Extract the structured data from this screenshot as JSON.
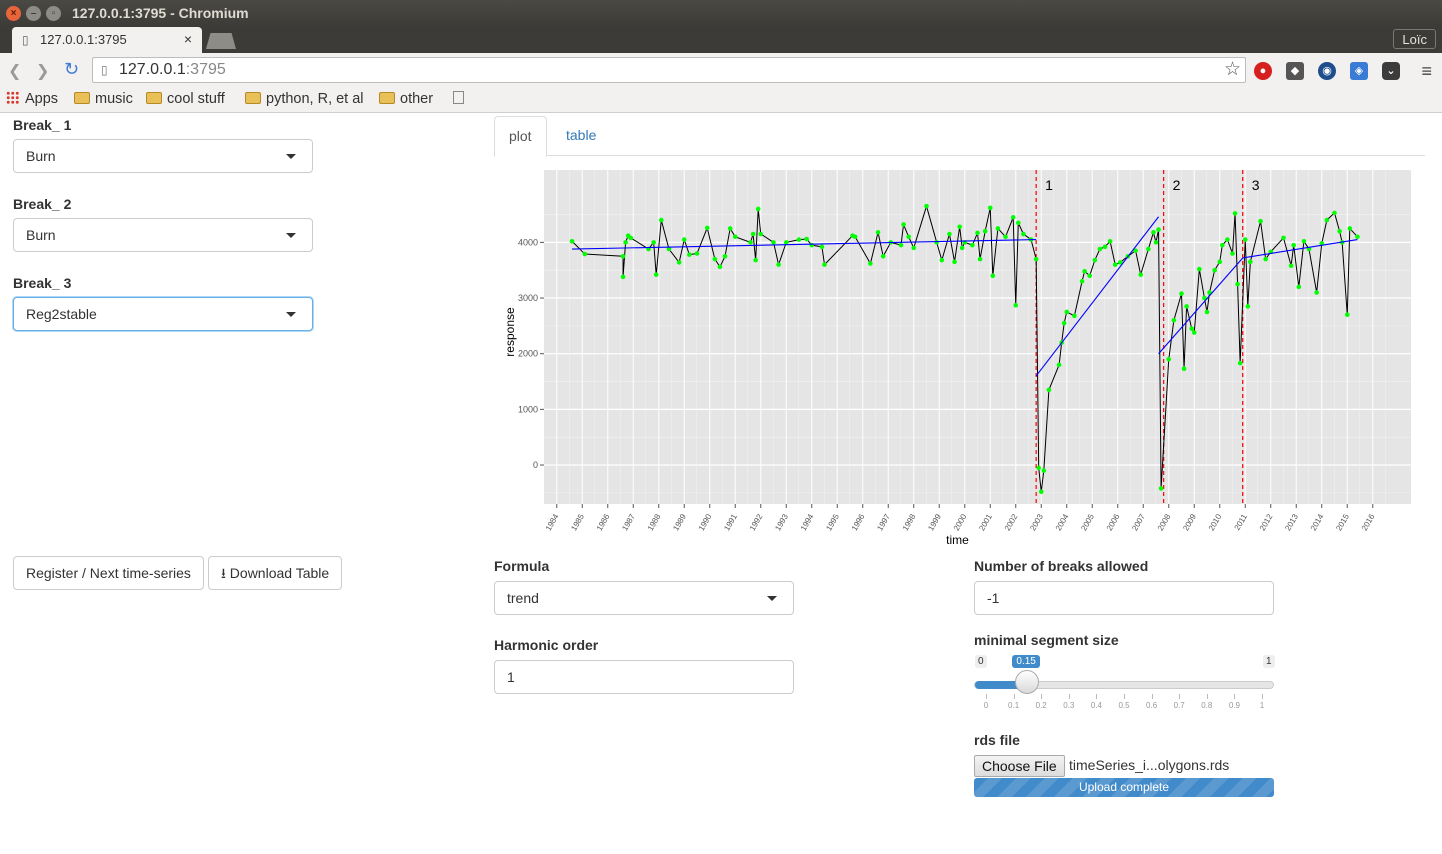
{
  "window": {
    "title": "127.0.0.1:3795 - Chromium",
    "tab_label": "127.0.0.1:3795",
    "profile": "Loïc",
    "url_host": "127.0.0.1",
    "url_port": ":3795"
  },
  "bookmarks": [
    "Apps",
    "music",
    "cool stuff",
    "python, R, et al",
    "other"
  ],
  "breaks": [
    {
      "label": "Break_ 1",
      "value": "Burn"
    },
    {
      "label": "Break_ 2",
      "value": "Burn"
    },
    {
      "label": "Break_ 3",
      "value": "Reg2stable"
    }
  ],
  "buttons": {
    "register": "Register / Next time-series",
    "download": "Download Table"
  },
  "tabs": {
    "plot": "plot",
    "table": "table"
  },
  "formula": {
    "label": "Formula",
    "value": "trend"
  },
  "harmonic": {
    "label": "Harmonic order",
    "value": "1"
  },
  "breaks_allowed": {
    "label": "Number of breaks allowed",
    "value": "-1"
  },
  "segment": {
    "label": "minimal segment size",
    "min": "0",
    "max": "1",
    "value": "0.15",
    "value_num": 0.15,
    "grid": [
      "0",
      "0.1",
      "0.2",
      "0.3",
      "0.4",
      "0.5",
      "0.6",
      "0.7",
      "0.8",
      "0.9",
      "1"
    ]
  },
  "rds": {
    "label": "rds file",
    "choose": "Choose File",
    "filename": "timeSeries_i...olygons.rds",
    "status": "Upload complete",
    "progress": 1.0
  },
  "colors": {
    "accent": "#428bca",
    "points": "#00ff00",
    "fit": "#0000ff",
    "breaks": "#ff0000"
  },
  "chart_data": {
    "type": "line",
    "xlabel": "time",
    "ylabel": "response",
    "xlim": [
      1983.5,
      2017.5
    ],
    "ylim": [
      -700,
      5300
    ],
    "yticks": [
      0,
      1000,
      2000,
      3000,
      4000
    ],
    "xticks": [
      1984,
      1985,
      1986,
      1987,
      1988,
      1989,
      1990,
      1991,
      1992,
      1993,
      1994,
      1995,
      1996,
      1997,
      1998,
      1999,
      2000,
      2001,
      2002,
      2003,
      2004,
      2005,
      2006,
      2007,
      2008,
      2009,
      2010,
      2011,
      2012,
      2013,
      2014,
      2015,
      2016
    ],
    "series": [
      {
        "values": [
          [
            1984.6,
            4020
          ],
          [
            1985.1,
            3790
          ],
          [
            1986.6,
            3750
          ],
          [
            1986.6,
            3380
          ],
          [
            1986.7,
            4000
          ],
          [
            1986.8,
            4120
          ],
          [
            1986.9,
            4080
          ],
          [
            1987.6,
            3880
          ],
          [
            1987.8,
            4000
          ],
          [
            1987.9,
            3420
          ],
          [
            1988.1,
            4400
          ],
          [
            1988.4,
            3880
          ],
          [
            1988.8,
            3640
          ],
          [
            1989.0,
            4050
          ],
          [
            1989.2,
            3780
          ],
          [
            1989.5,
            3800
          ],
          [
            1989.9,
            4260
          ],
          [
            1990.2,
            3700
          ],
          [
            1990.4,
            3560
          ],
          [
            1990.6,
            3750
          ],
          [
            1990.8,
            4250
          ],
          [
            1991.0,
            4100
          ],
          [
            1991.6,
            4000
          ],
          [
            1991.7,
            4150
          ],
          [
            1991.8,
            3680
          ],
          [
            1991.9,
            4600
          ],
          [
            1992.0,
            4150
          ],
          [
            1992.5,
            4000
          ],
          [
            1992.7,
            3600
          ],
          [
            1993.0,
            4000
          ],
          [
            1993.5,
            4050
          ],
          [
            1993.8,
            4060
          ],
          [
            1994.0,
            3950
          ],
          [
            1994.4,
            3920
          ],
          [
            1994.5,
            3600
          ],
          [
            1995.6,
            4120
          ],
          [
            1995.7,
            4100
          ],
          [
            1996.3,
            3620
          ],
          [
            1996.6,
            4180
          ],
          [
            1996.8,
            3750
          ],
          [
            1997.1,
            4000
          ],
          [
            1997.5,
            3950
          ],
          [
            1997.6,
            4320
          ],
          [
            1997.8,
            4100
          ],
          [
            1998.0,
            3900
          ],
          [
            1998.5,
            4650
          ],
          [
            1998.9,
            4000
          ],
          [
            1999.1,
            3680
          ],
          [
            1999.4,
            4150
          ],
          [
            1999.6,
            3650
          ],
          [
            1999.8,
            4280
          ],
          [
            1999.9,
            3900
          ],
          [
            2000.0,
            4000
          ],
          [
            2000.3,
            3950
          ],
          [
            2000.5,
            4170
          ],
          [
            2000.6,
            3700
          ],
          [
            2000.8,
            4200
          ],
          [
            2001.0,
            4620
          ],
          [
            2001.1,
            3400
          ],
          [
            2001.3,
            4250
          ],
          [
            2001.6,
            4100
          ],
          [
            2001.9,
            4450
          ],
          [
            2002.0,
            2870
          ],
          [
            2002.1,
            4350
          ],
          [
            2002.3,
            4150
          ],
          [
            2002.6,
            4050
          ],
          [
            2002.8,
            3700
          ],
          [
            2002.9,
            -50
          ],
          [
            2003.0,
            -480
          ],
          [
            2003.1,
            -100
          ],
          [
            2003.3,
            1350
          ],
          [
            2003.7,
            1800
          ],
          [
            2003.8,
            2200
          ],
          [
            2003.9,
            2550
          ],
          [
            2004.0,
            2750
          ],
          [
            2004.3,
            2680
          ],
          [
            2004.6,
            3300
          ],
          [
            2004.7,
            3480
          ],
          [
            2004.9,
            3400
          ],
          [
            2005.1,
            3680
          ],
          [
            2005.3,
            3880
          ],
          [
            2005.5,
            3920
          ],
          [
            2005.7,
            4020
          ],
          [
            2005.9,
            3600
          ],
          [
            2006.1,
            3640
          ],
          [
            2006.4,
            3750
          ],
          [
            2006.7,
            3850
          ],
          [
            2006.9,
            3420
          ],
          [
            2007.2,
            3880
          ],
          [
            2007.4,
            4180
          ],
          [
            2007.5,
            4000
          ],
          [
            2007.6,
            4230
          ],
          [
            2007.7,
            -420
          ],
          [
            2008.0,
            1900
          ],
          [
            2008.2,
            2600
          ],
          [
            2008.5,
            3080
          ],
          [
            2008.6,
            1730
          ],
          [
            2008.7,
            2850
          ],
          [
            2008.9,
            2450
          ],
          [
            2009.0,
            2380
          ],
          [
            2009.2,
            3520
          ],
          [
            2009.4,
            3000
          ],
          [
            2009.5,
            2750
          ],
          [
            2009.6,
            3100
          ],
          [
            2009.8,
            3500
          ],
          [
            2010.0,
            3650
          ],
          [
            2010.1,
            3950
          ],
          [
            2010.3,
            4050
          ],
          [
            2010.5,
            3800
          ],
          [
            2010.6,
            4520
          ],
          [
            2010.7,
            3250
          ],
          [
            2010.8,
            1830
          ],
          [
            2011.0,
            4050
          ],
          [
            2011.1,
            2850
          ],
          [
            2011.2,
            3650
          ],
          [
            2011.6,
            4380
          ],
          [
            2011.8,
            3700
          ],
          [
            2012.0,
            3830
          ],
          [
            2012.5,
            4080
          ],
          [
            2012.8,
            3580
          ],
          [
            2012.9,
            3950
          ],
          [
            2013.1,
            3200
          ],
          [
            2013.3,
            4020
          ],
          [
            2013.5,
            3880
          ],
          [
            2013.8,
            3100
          ],
          [
            2014.0,
            3980
          ],
          [
            2014.2,
            4400
          ],
          [
            2014.5,
            4530
          ],
          [
            2014.7,
            4200
          ],
          [
            2014.8,
            4000
          ],
          [
            2015.0,
            2700
          ],
          [
            2015.1,
            4250
          ],
          [
            2015.4,
            4100
          ]
        ]
      }
    ],
    "fit_segments": [
      [
        [
          1984.6,
          3880
        ],
        [
          2002.8,
          4050
        ]
      ],
      [
        [
          2002.8,
          1600
        ],
        [
          2007.6,
          4460
        ]
      ],
      [
        [
          2007.6,
          2000
        ],
        [
          2010.9,
          3720
        ]
      ],
      [
        [
          2010.9,
          3720
        ],
        [
          2015.4,
          4050
        ]
      ]
    ],
    "breakpoints": [
      {
        "x": 2002.8,
        "label": "1"
      },
      {
        "x": 2007.8,
        "label": "2"
      },
      {
        "x": 2010.9,
        "label": "3"
      }
    ],
    "grid": true
  }
}
